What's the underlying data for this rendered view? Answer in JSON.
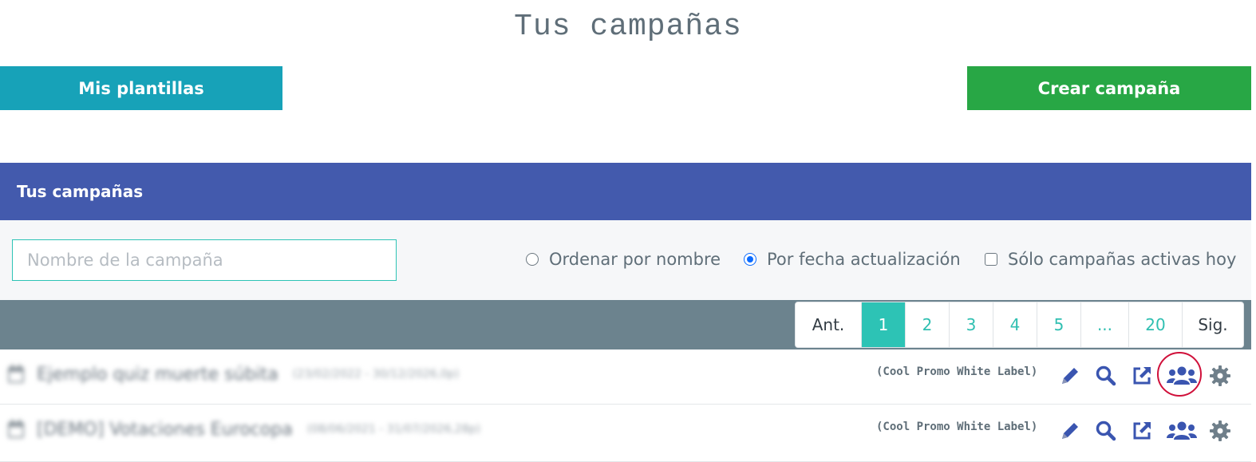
{
  "page": {
    "title": "Tus campañas"
  },
  "top_buttons": {
    "templates_label": "Mis plantillas",
    "create_label": "Crear campaña"
  },
  "panel": {
    "title": "Tus campañas"
  },
  "filters": {
    "search_placeholder": "Nombre de la campaña",
    "sort_by_name": "Ordenar por nombre",
    "sort_by_date": "Por fecha actualización",
    "sort_selected": "Por fecha actualización",
    "only_active": "Sólo campañas activas hoy",
    "only_active_checked": false
  },
  "pagination": {
    "prev": "Ant.",
    "pages": [
      "1",
      "2",
      "3",
      "4",
      "5",
      "...",
      "20"
    ],
    "current": "1",
    "next": "Sig."
  },
  "campaigns": [
    {
      "name": "Ejemplo quiz muerte súbita",
      "dates": "(23/02/2022 - 30/12/2026,0p)",
      "label": "(Cool Promo White Label)"
    },
    {
      "name": "[DEMO] Votaciones Eurocopa",
      "dates": "(08/06/2021 - 31/07/2026,28p)",
      "label": "(Cool Promo White Label)"
    }
  ],
  "colors": {
    "accent_teal": "#2dc3b5",
    "templates_button": "#17a2b8",
    "create_button": "#28a745",
    "panel_header": "#435aad",
    "pager_bar": "#6c838e",
    "action_icons": "#3a55b0",
    "highlight_ring": "#d0103a"
  },
  "icons": [
    "calendar-icon",
    "pencil-icon",
    "search-icon",
    "external-link-icon",
    "users-icon",
    "gear-icon"
  ]
}
